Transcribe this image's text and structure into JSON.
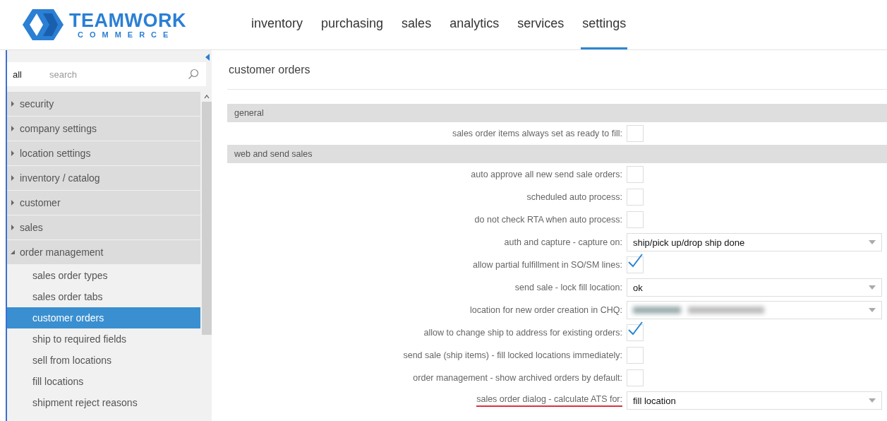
{
  "logo": {
    "name": "TEAMWORK",
    "sub": "COMMERCE"
  },
  "nav": [
    {
      "label": "inventory",
      "selected": false
    },
    {
      "label": "purchasing",
      "selected": false
    },
    {
      "label": "sales",
      "selected": false
    },
    {
      "label": "analytics",
      "selected": false
    },
    {
      "label": "services",
      "selected": false
    },
    {
      "label": "settings",
      "selected": true
    }
  ],
  "sidebar": {
    "filter": "all",
    "search": {
      "placeholder": "search"
    },
    "items": [
      {
        "label": "security",
        "expanded": false
      },
      {
        "label": "company settings",
        "expanded": false
      },
      {
        "label": "location settings",
        "expanded": false
      },
      {
        "label": "inventory / catalog",
        "expanded": false
      },
      {
        "label": "customer",
        "expanded": false
      },
      {
        "label": "sales",
        "expanded": false
      },
      {
        "label": "order management",
        "expanded": true,
        "children": [
          {
            "label": "sales order types",
            "selected": false
          },
          {
            "label": "sales order tabs",
            "selected": false
          },
          {
            "label": "customer orders",
            "selected": true
          },
          {
            "label": "ship to required fields",
            "selected": false
          },
          {
            "label": "sell from locations",
            "selected": false
          },
          {
            "label": "fill locations",
            "selected": false
          },
          {
            "label": "shipment reject reasons",
            "selected": false
          }
        ]
      }
    ]
  },
  "page_title": "customer orders",
  "sections": [
    {
      "title": "general",
      "rows": [
        {
          "kind": "checkbox",
          "label": "sales order items always set as ready to fill:",
          "checked": false
        }
      ]
    },
    {
      "title": "web and send sales",
      "rows": [
        {
          "kind": "checkbox",
          "label": "auto approve all new send sale orders:",
          "checked": false
        },
        {
          "kind": "checkbox",
          "label": "scheduled auto process:",
          "checked": false
        },
        {
          "kind": "checkbox",
          "label": "do not check RTA when auto process:",
          "checked": false
        },
        {
          "kind": "select",
          "label": "auth and capture - capture on:",
          "value": "ship/pick up/drop ship done"
        },
        {
          "kind": "checkbox",
          "label": "allow partial fulfillment in SO/SM lines:",
          "checked": true
        },
        {
          "kind": "select",
          "label": "send sale - lock fill location:",
          "value": "ok"
        },
        {
          "kind": "select",
          "label": "location for new order creation in CHQ:",
          "blurred": true
        },
        {
          "kind": "checkbox",
          "label": "allow to change ship to address for existing orders:",
          "checked": true
        },
        {
          "kind": "checkbox",
          "label": "send sale (ship items) - fill locked locations immediately:",
          "checked": false
        },
        {
          "kind": "checkbox",
          "label": "order management - show archived orders by default:",
          "checked": false
        },
        {
          "kind": "select",
          "label": "sales order dialog - calculate ATS for:",
          "value": "fill location",
          "underlined": true
        }
      ]
    }
  ]
}
